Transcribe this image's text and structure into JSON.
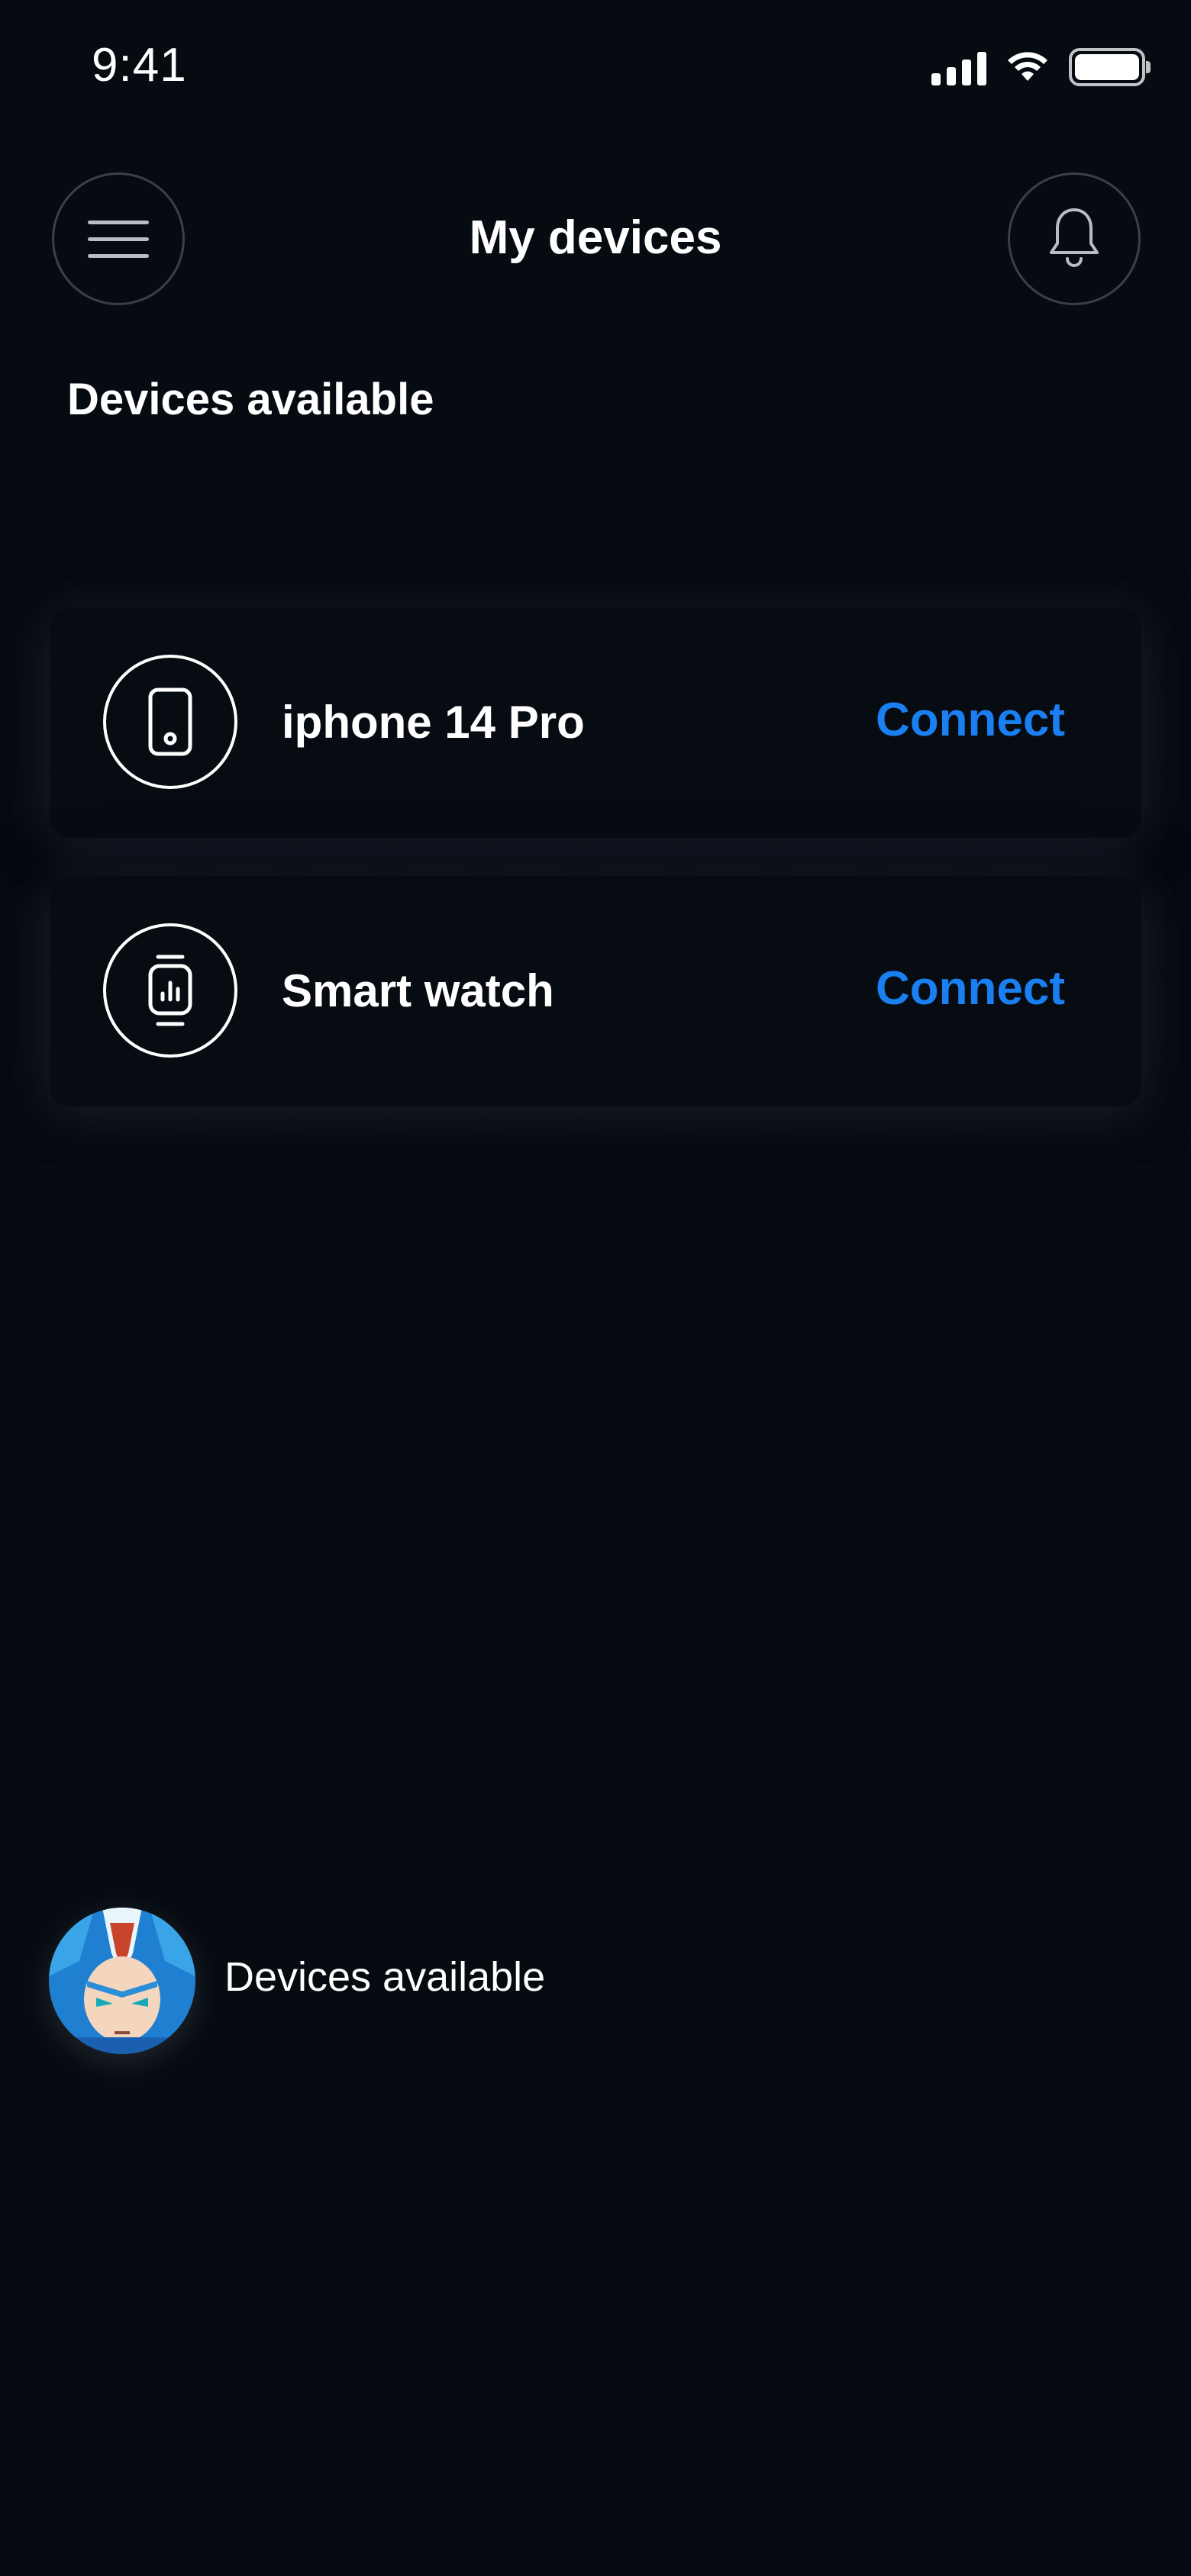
{
  "status_bar": {
    "time": "9:41",
    "icons": [
      "signal-icon",
      "wifi-icon",
      "battery-icon"
    ]
  },
  "header": {
    "title": "My devices",
    "menu_icon": "hamburger-menu-icon",
    "notification_icon": "bell-icon"
  },
  "section": {
    "title": "Devices available"
  },
  "devices": [
    {
      "name": "iphone 14 Pro",
      "icon": "phone-icon",
      "action": "Connect"
    },
    {
      "name": "Smart watch",
      "icon": "smartwatch-icon",
      "action": "Connect"
    }
  ],
  "footer": {
    "avatar": "user-avatar",
    "text": "Devices available"
  },
  "colors": {
    "background": "#060a11",
    "accent": "#1a7ff0",
    "text": "#ffffff",
    "button_border": "#3b3f46"
  }
}
